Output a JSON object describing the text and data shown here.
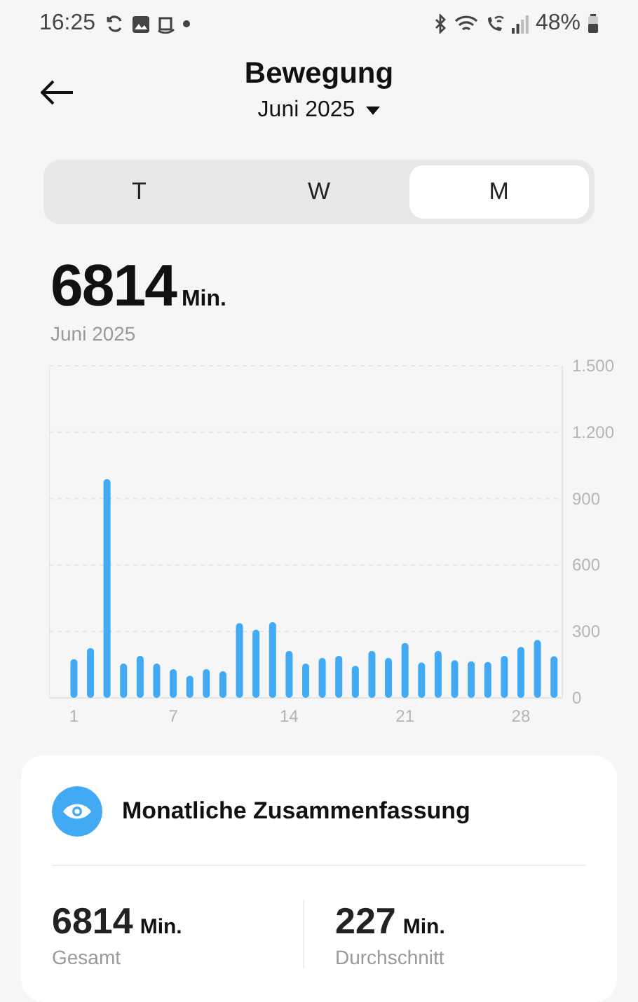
{
  "status_bar": {
    "time": "16:25",
    "battery": "48%"
  },
  "header": {
    "title": "Bewegung",
    "period": "Juni 2025"
  },
  "tabs": [
    {
      "label": "T",
      "selected": false
    },
    {
      "label": "W",
      "selected": false
    },
    {
      "label": "M",
      "selected": true
    }
  ],
  "total": {
    "value": "6814",
    "unit": "Min.",
    "period": "Juni 2025"
  },
  "chart": {
    "chart_data": {
      "type": "bar",
      "x": [
        1,
        2,
        3,
        4,
        5,
        6,
        7,
        8,
        9,
        10,
        11,
        12,
        13,
        14,
        15,
        16,
        17,
        18,
        19,
        20,
        21,
        22,
        23,
        24,
        25,
        26,
        27,
        28,
        29,
        30
      ],
      "grid": true,
      "xlim": [
        -0.5,
        30.5
      ],
      "series": [
        {
          "color": "#42a9f5",
          "values": [
            175,
            225,
            988,
            155,
            190,
            155,
            130,
            100,
            130,
            120,
            338,
            308,
            342,
            212,
            155,
            180,
            190,
            145,
            212,
            180,
            248,
            160,
            212,
            170,
            165,
            162,
            190,
            230,
            262,
            188
          ]
        }
      ],
      "ylim": [
        0,
        1500
      ],
      "yticks": [
        {
          "value": 0,
          "label": "0"
        },
        {
          "value": 300,
          "label": "300"
        },
        {
          "value": 600,
          "label": "600"
        },
        {
          "value": 900,
          "label": "900"
        },
        {
          "value": 1200,
          "label": "1.200"
        },
        {
          "value": 1500,
          "label": "1.500"
        }
      ],
      "xticks": [
        1,
        7,
        14,
        21,
        28
      ]
    }
  },
  "summary": {
    "title": "Monatliche Zusammenfassung",
    "stats": [
      {
        "value": "6814",
        "unit": "Min.",
        "label": "Gesamt"
      },
      {
        "value": "227",
        "unit": "Min.",
        "label": "Durchschnitt"
      }
    ]
  }
}
